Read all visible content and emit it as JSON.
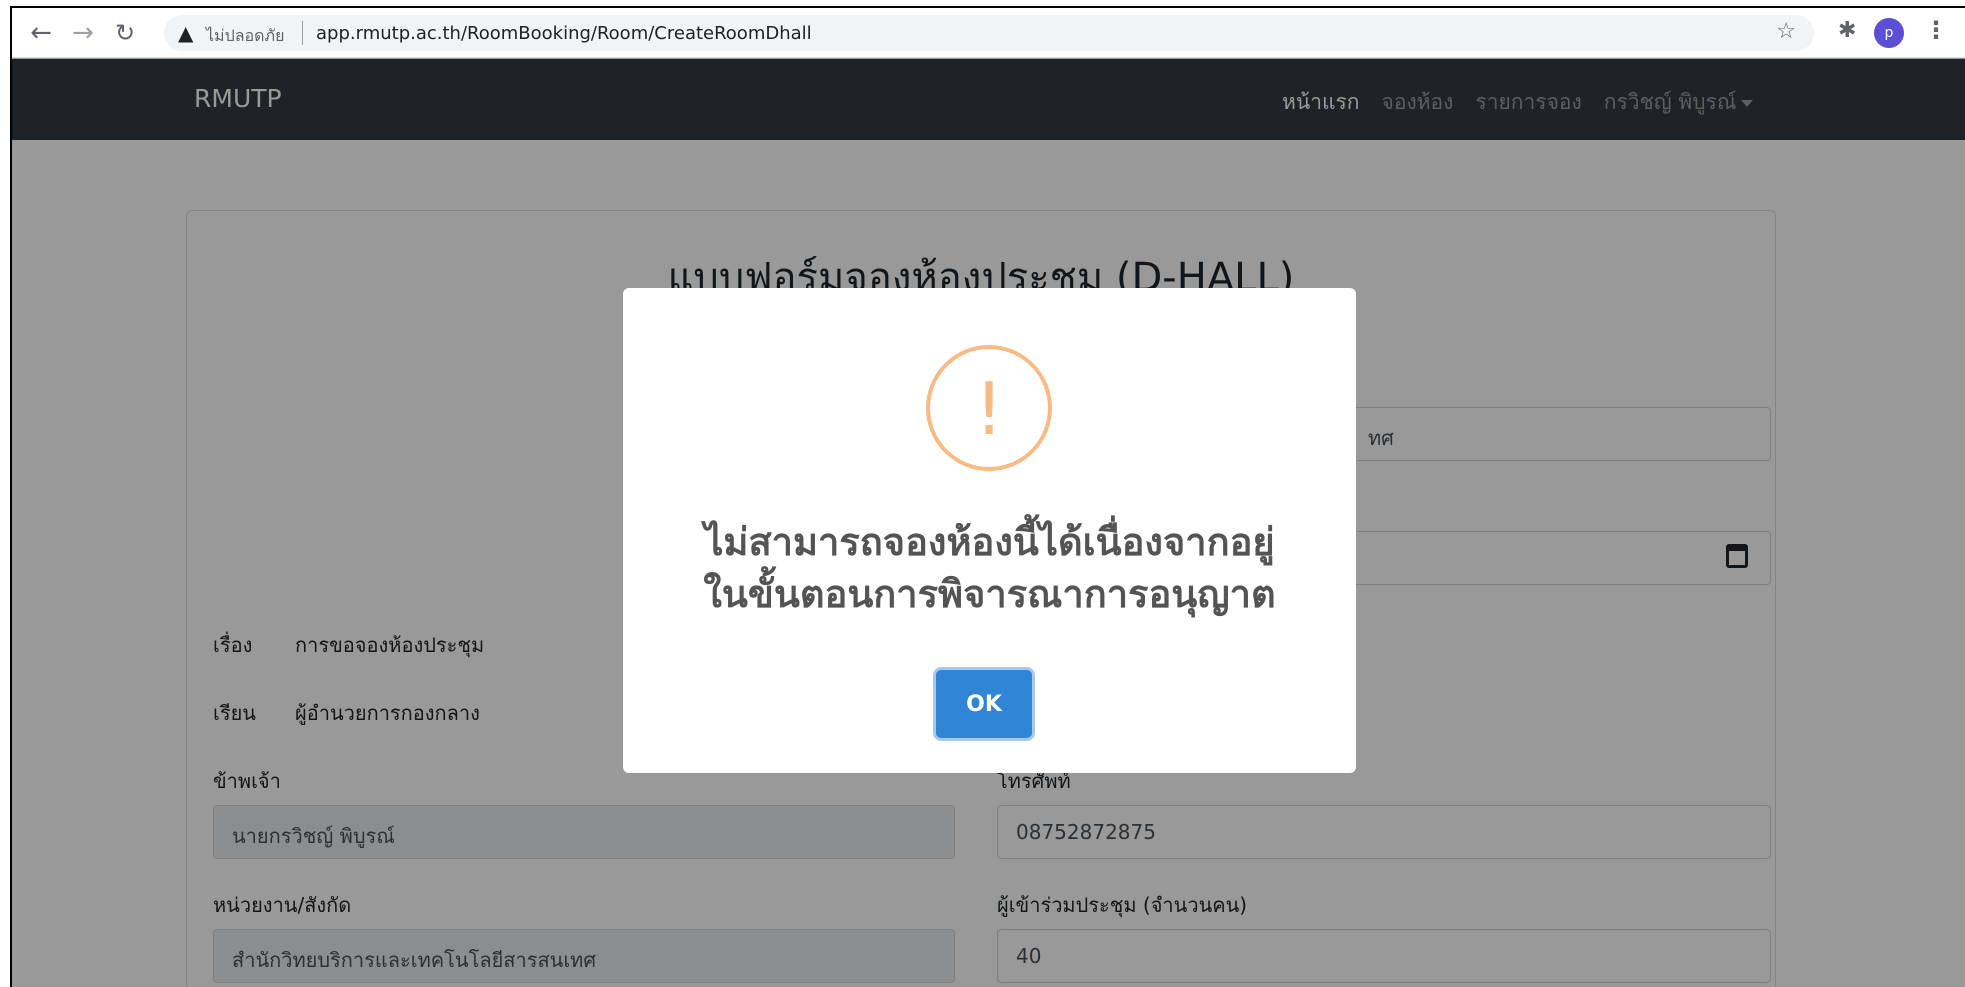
{
  "browser": {
    "security_label": "ไม่ปลอดภัย",
    "url": "app.rmutp.ac.th/RoomBooking/Room/CreateRoomDhall",
    "profile_initial": "p"
  },
  "navbar": {
    "brand": "RMUTP",
    "links": [
      {
        "label": "หน้าแรก"
      },
      {
        "label": "จองห้อง"
      },
      {
        "label": "รายการจอง"
      },
      {
        "label": "กรวิชญ์ พิบูรณ์"
      }
    ]
  },
  "form": {
    "title": "แบบฟอร์มจองห้องประชุม (D-HALL)",
    "top_field_value_fragment": "ทศ",
    "subject_label": "เรื่อง",
    "subject_value": "การขอจองห้องประชุม",
    "to_label": "เรียน",
    "to_value": "ผู้อำนวยการกองกลาง",
    "name_label": "ข้าพเจ้า",
    "name_value": "นายกรวิชญ์  พิบูรณ์",
    "phone_label": "โทรศัพท์",
    "phone_value": "08752872875",
    "unit_label": "หน่วยงาน/สังกัด",
    "unit_value": "สำนักวิทยบริการและเทคโนโลยีสารสนเทศ",
    "attendees_label": "ผู้เข้าร่วมประชุม (จำนวนคน)",
    "attendees_value": "40"
  },
  "modal": {
    "icon": "!",
    "message_line1": "ไม่สามารถจองห้องนี้ได้เนื่องจากอยู่",
    "message_line2": "ในขั้นตอนการพิจารณาการอนุญาต",
    "ok_label": "OK"
  }
}
